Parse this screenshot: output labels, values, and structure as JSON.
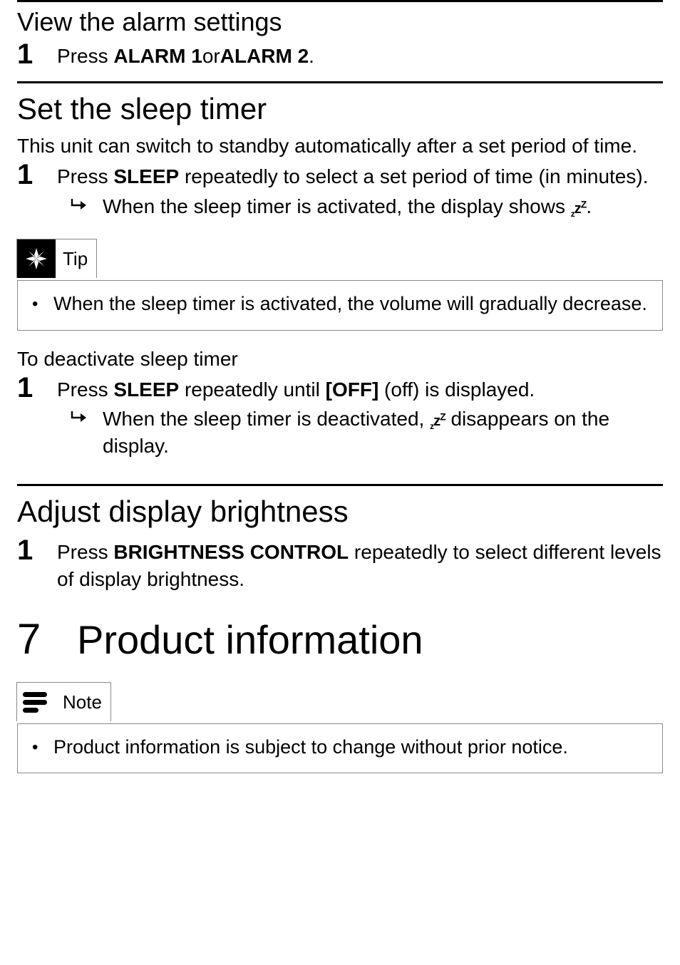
{
  "section_view_alarm": {
    "heading": "View the alarm settings",
    "step1_num": "1",
    "step1_press": "Press ",
    "step1_btn1": "ALARM 1",
    "step1_or": "or",
    "step1_btn2": "ALARM 2",
    "step1_end": "."
  },
  "section_sleep": {
    "heading": "Set the sleep timer",
    "intro": "This unit can switch to standby automatically after a set period of time.",
    "step1_num": "1",
    "step1_press": "Press ",
    "step1_btn": "SLEEP",
    "step1_rest": " repeatedly to select a set period of time (in minutes).",
    "sub1_text_a": "When the sleep timer is activated, the display shows ",
    "sub1_text_b": ".",
    "tip_label": "Tip",
    "tip_body": "When the sleep timer is activated, the volume will gradually decrease.",
    "deact_heading": "To deactivate sleep timer",
    "deact_step_num": "1",
    "deact_press": "Press ",
    "deact_btn": "SLEEP",
    "deact_mid": " repeatedly until ",
    "deact_off": "[OFF]",
    "deact_rest": " (off) is displayed.",
    "deact_sub_a": "When the sleep timer is deactivated, ",
    "deact_sub_b": " disappears on the display."
  },
  "section_brightness": {
    "heading": "Adjust display brightness",
    "step1_num": "1",
    "step1_press": "Press ",
    "step1_btn": "BRIGHTNESS CONTROL",
    "step1_rest": " repeatedly to select different levels of display brightness."
  },
  "chapter7": {
    "num": "7",
    "title": "Product information",
    "note_label": "Note",
    "note_body": "Product information is subject to change without prior notice."
  }
}
